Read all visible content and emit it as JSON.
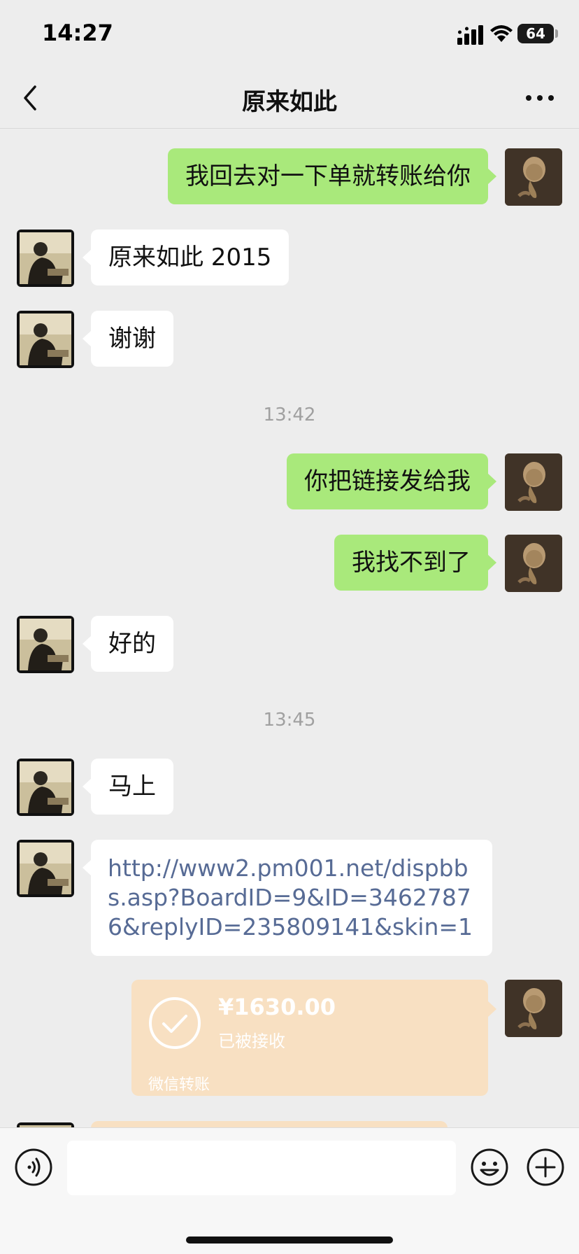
{
  "status_bar": {
    "time": "14:27",
    "battery": "64"
  },
  "nav": {
    "title": "原来如此"
  },
  "messages": [
    {
      "type": "text",
      "sender": "me",
      "text": "我回去对一下单就转账给你"
    },
    {
      "type": "text",
      "sender": "them",
      "text": "原来如此 2015"
    },
    {
      "type": "text",
      "sender": "them",
      "text": "谢谢"
    },
    {
      "type": "timestamp",
      "text": "13:42"
    },
    {
      "type": "text",
      "sender": "me",
      "text": "你把链接发给我"
    },
    {
      "type": "text",
      "sender": "me",
      "text": "我找不到了"
    },
    {
      "type": "text",
      "sender": "them",
      "text": "好的"
    },
    {
      "type": "timestamp",
      "text": "13:45"
    },
    {
      "type": "text",
      "sender": "them",
      "text": "马上"
    },
    {
      "type": "link",
      "sender": "them",
      "text": "http://www2.pm001.net/dispbbs.asp?BoardID=9&ID=34627876&replyID=235809141&skin=1"
    },
    {
      "type": "transfer",
      "sender": "me",
      "amount": "¥1630.00",
      "status": "已被接收",
      "source": "微信转账"
    }
  ],
  "input": {
    "value": "",
    "placeholder": ""
  },
  "colors": {
    "my_bubble": "#a9e97b",
    "their_bubble": "#ffffff",
    "transfer_card": "#f8e0c2",
    "link": "#576b95",
    "background": "#ededed"
  }
}
